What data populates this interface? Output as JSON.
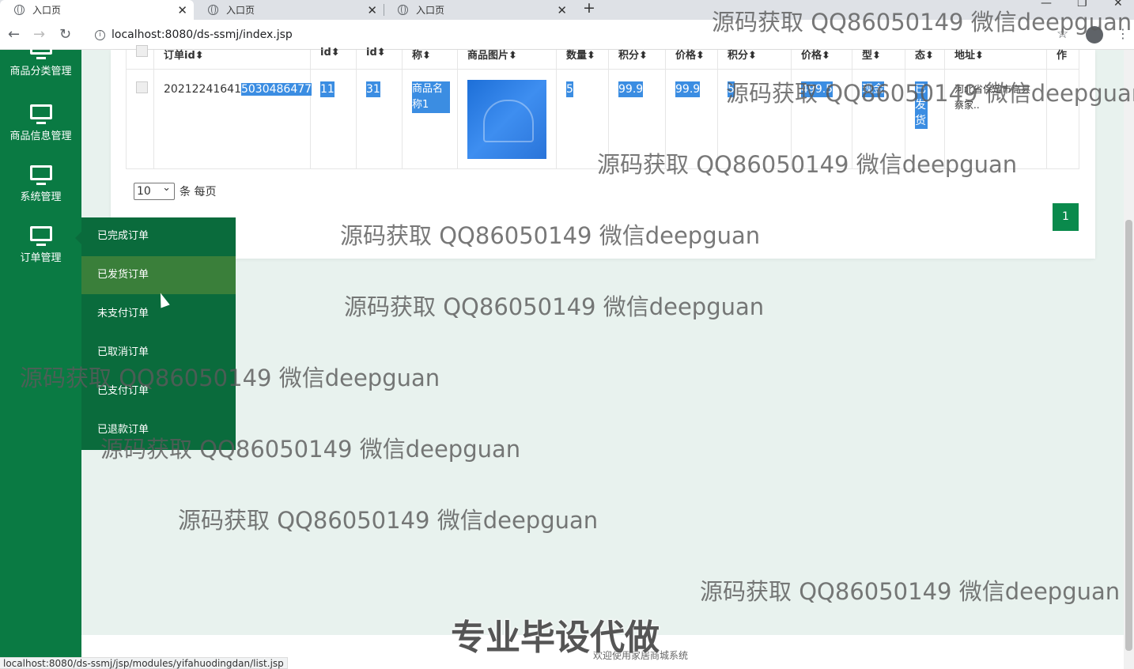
{
  "browser": {
    "tabs": [
      "入口页",
      "入口页",
      "入口页"
    ],
    "new_tab": "+",
    "url": "localhost:8080/ds-ssmj/index.jsp",
    "status_url": "localhost:8080/ds-ssmj/jsp/modules/yifahuodingdan/list.jsp"
  },
  "sidebar": {
    "items": [
      {
        "label": "商品分类管理",
        "icon": "monitor-icon"
      },
      {
        "label": "商品信息管理",
        "icon": "monitor-icon"
      },
      {
        "label": "系统管理",
        "icon": "monitor-icon"
      },
      {
        "label": "订单管理",
        "icon": "monitor-icon"
      }
    ],
    "submenu": [
      "已完成订单",
      "已发货订单",
      "未支付订单",
      "已取消订单",
      "已支付订单",
      "已退款订单"
    ]
  },
  "table": {
    "headers": [
      "订单id",
      "id",
      "id",
      "称",
      "商品图片",
      "数量",
      "积分",
      "价格",
      "积分",
      "价格",
      "型",
      "态",
      "地址",
      "作"
    ],
    "row": {
      "order_id_prefix": "20212241641",
      "order_id_selected": "5030486477",
      "id1": "11",
      "id2": "31",
      "name": "商品名称1",
      "qty": "5",
      "points": "99.9",
      "price": "99.9",
      "total_points": "5",
      "total_price": "499.5",
      "type": "现金",
      "status": "已发货",
      "address": "河北省保定市高县蔡家.."
    }
  },
  "pager": {
    "page_size": "10",
    "page_size_label": "条 每页",
    "current_page": "1"
  },
  "footer": {
    "text": "欢迎使用家居商城系统"
  },
  "watermarks": {
    "text": "源码获取 QQ86050149 微信deepguan",
    "big": "专业毕设代做"
  }
}
